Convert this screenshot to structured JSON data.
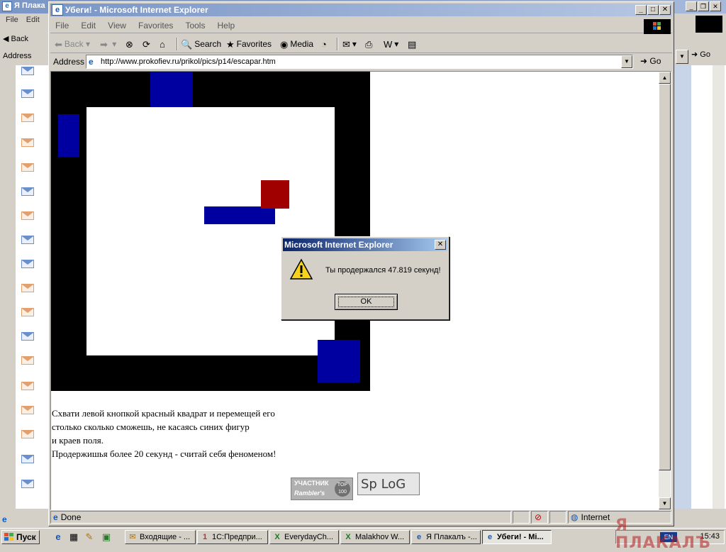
{
  "background_window": {
    "title": "Я Плака",
    "menu": [
      "File",
      "Edit"
    ],
    "back_label": "Back",
    "address_label": "Address",
    "go_label": "Go"
  },
  "window": {
    "title": "Убеги! - Microsoft Internet Explorer",
    "menu": [
      "File",
      "Edit",
      "View",
      "Favorites",
      "Tools",
      "Help"
    ],
    "toolbar": {
      "back": "Back",
      "search": "Search",
      "favorites": "Favorites",
      "media": "Media"
    },
    "address_label": "Address",
    "url": "http://www.prokofiev.ru/prikol/pics/p14/escapar.htm",
    "go_label": "Go"
  },
  "page": {
    "instructions": [
      "Схвати левой кнопкой красный квадрат и перемещей его",
      "столько сколько сможешь, не касаясь синих фигур",
      "и краев поля.",
      "Продержишья более 20 секунд - считай себя феноменом!"
    ],
    "badges": {
      "rambler_line1": "УЧАСТНИК",
      "rambler_line2": "Rambler's",
      "rambler_top": "TOP 100",
      "spylog": "Sp LoG"
    }
  },
  "statusbar": {
    "status": "Done",
    "zone": "Internet"
  },
  "dialog": {
    "title": "Microsoft Internet Explorer",
    "message": "Ты продержался 47.819 секунд!",
    "ok": "OK"
  },
  "taskbar": {
    "start": "Пуск",
    "tasks": [
      {
        "label": "Входящие - ..."
      },
      {
        "label": "1С:Предпри..."
      },
      {
        "label": "EverydayCh..."
      },
      {
        "label": "Malakhov W..."
      },
      {
        "label": "Я Плакалъ -..."
      },
      {
        "label": "Убеги! - Mi..."
      }
    ],
    "lang": "EN",
    "time": "15:43",
    "watermark": "Я ПЛАКАЛЪ"
  }
}
